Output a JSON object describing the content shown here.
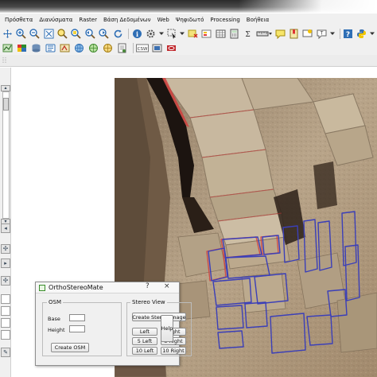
{
  "menu": {
    "items": [
      "Πρόσθετα",
      "Διανύσματα",
      "Raster",
      "Βάση Δεδομένων",
      "Web",
      "Ψηφιδωτό",
      "Processing",
      "Βοήθεια"
    ]
  },
  "toolbar1": {
    "icons": [
      "pan-icon",
      "zoom-in-icon",
      "zoom-out-icon",
      "zoom-full-icon",
      "zoom-layer-icon",
      "zoom-selection-icon",
      "zoom-last-icon",
      "zoom-next-icon",
      "refresh-icon",
      "identify-icon",
      "action-icon",
      "select-icon",
      "deselect-icon",
      "attribute-table-icon",
      "field-calculator-icon",
      "statistics-icon",
      "measure-icon",
      "map-tips-icon",
      "bookmark-icon",
      "annotation-icon",
      "text-annotation-icon",
      "help-icon",
      "python-icon"
    ]
  },
  "toolbar2": {
    "icons": [
      "add-vector-icon",
      "add-raster-icon",
      "add-postgis-icon",
      "add-spatialite-icon",
      "add-mssql-icon",
      "add-wms-icon",
      "add-wcs-icon",
      "add-wfs-icon",
      "add-delimited-icon",
      "add-csw-icon",
      "new-layer-icon",
      "oracle-icon"
    ],
    "csw_label": "CSW"
  },
  "dialog": {
    "title": "OrthoStereoMate",
    "question_mark": "?",
    "close_glyph": "×",
    "osm_group": "OSM",
    "base_label": "Base",
    "height_label": "Height",
    "base_value": "",
    "height_value": "",
    "create_osm": "Create OSM",
    "stereo_group": "Stereo View",
    "create_stereo": "Create Stereo Image",
    "left": "Left",
    "right": "Right",
    "five_left": "5 Left",
    "five_right": "5 Right",
    "ten_left": "10 Left",
    "ten_right": "10 Right",
    "help": "Help"
  },
  "colors": {
    "map_stone": "#b9a58a",
    "polygon_blue": "#3b3fb8",
    "anaglyph_red": "#d43a3a"
  }
}
